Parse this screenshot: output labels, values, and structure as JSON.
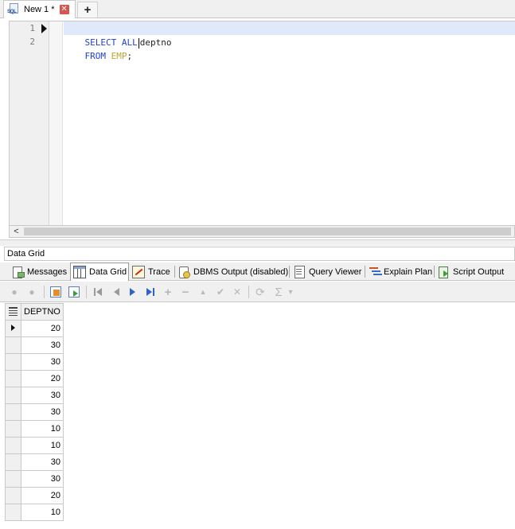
{
  "editor_tab": {
    "title": "New 1 *",
    "icon_text": "SQL",
    "close_symbol": "✕",
    "add_symbol": "+"
  },
  "editor": {
    "line_numbers": [
      "1",
      "2"
    ],
    "line1": {
      "kw1": "SELECT",
      "kw2": "ALL",
      "col": "deptno"
    },
    "line2": {
      "kw": "FROM",
      "table": "EMP",
      "end": ";"
    },
    "scroll_left_symbol": "<"
  },
  "panel": {
    "title": "Data Grid"
  },
  "result_tabs": [
    {
      "label": "Messages",
      "icon": "messages-icon"
    },
    {
      "label": "Data Grid",
      "icon": "data-grid-icon"
    },
    {
      "label": "Trace",
      "icon": "trace-icon"
    },
    {
      "label": "DBMS Output (disabled)",
      "icon": "dbms-output-icon"
    },
    {
      "label": "Query Viewer",
      "icon": "query-viewer-icon"
    },
    {
      "label": "Explain Plan",
      "icon": "explain-plan-icon"
    },
    {
      "label": "Script Output",
      "icon": "script-output-icon"
    }
  ],
  "active_result_tab": "Data Grid",
  "toolbar": {
    "insert_symbol": "+",
    "delete_symbol": "−",
    "edit_symbol": "▲",
    "post_symbol": "✔",
    "cancel_symbol": "✕",
    "refresh_symbol": "⟳",
    "sum_symbol": "Σ",
    "dropdown_symbol": "▾"
  },
  "grid": {
    "column": "DEPTNO",
    "rows": [
      "20",
      "30",
      "30",
      "20",
      "30",
      "30",
      "10",
      "10",
      "30",
      "30",
      "20",
      "10"
    ],
    "current_row": 0
  },
  "colors": {
    "keyword": "#1f3fcf",
    "table_name": "#b7a531",
    "active_line": "#dfe9f9",
    "close_button": "#d9534f"
  }
}
